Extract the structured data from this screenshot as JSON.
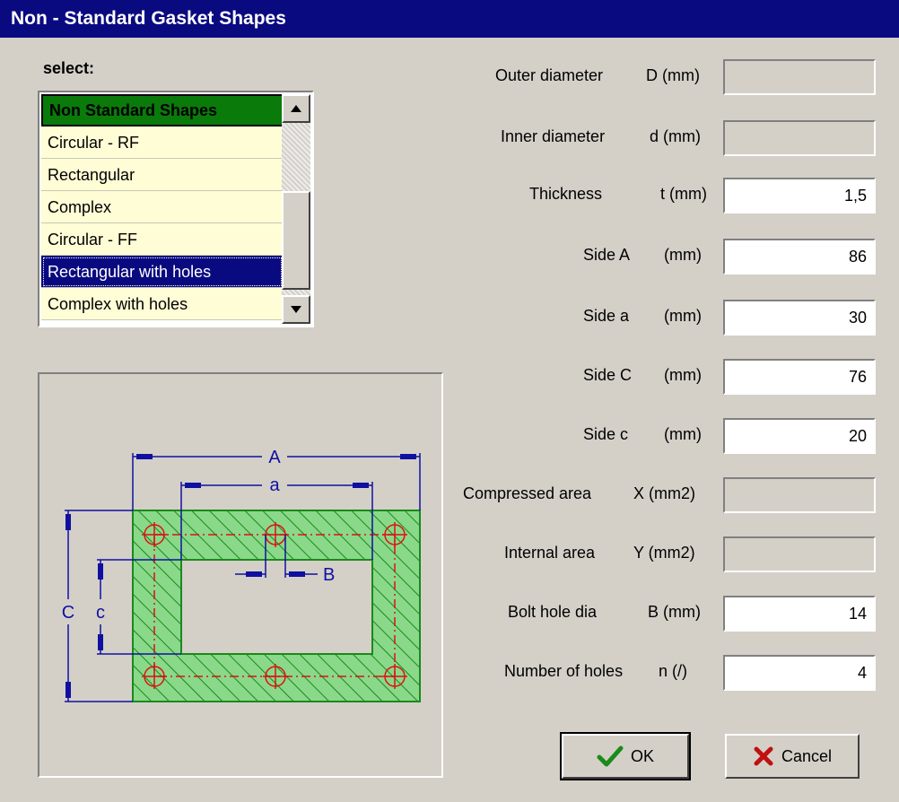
{
  "window": {
    "title": "Non - Standard Gasket Shapes"
  },
  "selector": {
    "label": "select:",
    "header": "Non Standard Shapes",
    "items": [
      {
        "label": "Circular - RF"
      },
      {
        "label": "Rectangular"
      },
      {
        "label": "Complex"
      },
      {
        "label": "Circular - FF"
      },
      {
        "label": "Rectangular with holes",
        "selected": true
      },
      {
        "label": "Complex with holes"
      }
    ]
  },
  "diagram": {
    "labels": {
      "A": "A",
      "a": "a",
      "B": "B",
      "C": "C",
      "c": "c"
    },
    "colors": {
      "hatch": "#1a8a1a",
      "fill": "#8ad88a",
      "dimension": "#1010a0",
      "centerline": "#e01010"
    }
  },
  "fields": [
    {
      "label": "Outer diameter",
      "unit": "D (mm)",
      "value": "",
      "enabled": false
    },
    {
      "label": "Inner diameter",
      "unit": "d (mm)",
      "value": "",
      "enabled": false
    },
    {
      "label": "Thickness",
      "unit": "t (mm)",
      "value": "1,5",
      "enabled": true
    },
    {
      "label": "Side A",
      "unit": "(mm)",
      "value": "86",
      "enabled": true
    },
    {
      "label": "Side a",
      "unit": "(mm)",
      "value": "30",
      "enabled": true
    },
    {
      "label": "Side C",
      "unit": "(mm)",
      "value": "76",
      "enabled": true
    },
    {
      "label": "Side c",
      "unit": "(mm)",
      "value": "20",
      "enabled": true
    },
    {
      "label": "Compressed area",
      "unit": "X (mm2)",
      "value": "",
      "enabled": false
    },
    {
      "label": "Internal area",
      "unit": "Y (mm2)",
      "value": "",
      "enabled": false
    },
    {
      "label": "Bolt hole dia",
      "unit": "B (mm)",
      "value": "14",
      "enabled": true
    },
    {
      "label": "Number of holes",
      "unit": "n (/)",
      "value": "4",
      "enabled": true
    }
  ],
  "buttons": {
    "ok": {
      "label": "OK",
      "icon": "checkmark-icon",
      "color": "#1a8a1a"
    },
    "cancel": {
      "label": "Cancel",
      "icon": "x-icon",
      "color": "#c01010"
    }
  }
}
